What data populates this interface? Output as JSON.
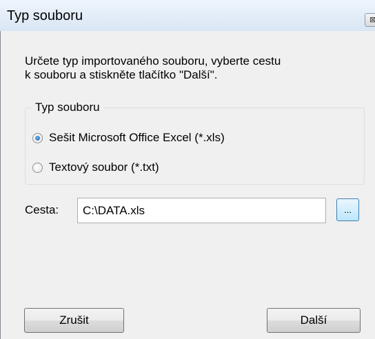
{
  "window": {
    "title": "Typ souboru",
    "close_glyph": "⊠"
  },
  "instructions": {
    "line1": "Určete typ importovaného souboru, vyberte cestu",
    "line2": "k souboru a stiskněte  tlačítko \"Další\"."
  },
  "file_type_group": {
    "label": "Typ souboru",
    "options": [
      {
        "label": "Sešit Microsoft Office Excel (*.xls)",
        "selected": true
      },
      {
        "label": "Textový soubor (*.txt)",
        "selected": false
      }
    ]
  },
  "path": {
    "label": "Cesta:",
    "value": "C:\\DATA.xls",
    "browse_label": "..."
  },
  "buttons": {
    "cancel_label": "Zrušit",
    "next_label": "Další"
  },
  "colors": {
    "titlebar": "#dbe8f6",
    "dialog_background": "#f0f0f0",
    "radio_selected": "#1c5ea6",
    "browse_button_border": "#3c7fb1"
  }
}
